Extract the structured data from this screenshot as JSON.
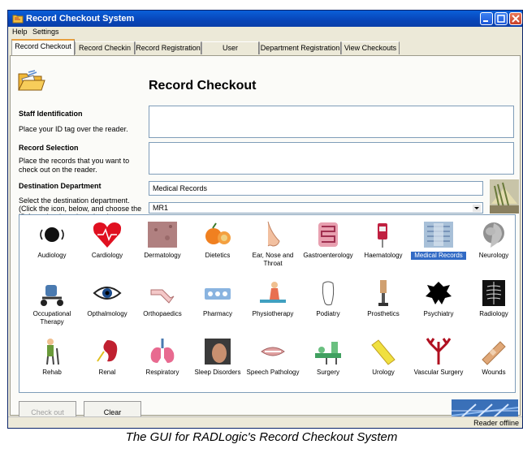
{
  "window": {
    "title": "Record Checkout System"
  },
  "menu": [
    "Help",
    "Settings"
  ],
  "tabs": [
    "Record Checkout",
    "Record Checkin",
    "Record Registration",
    "User Registration",
    "Department Registration",
    "View Checkouts"
  ],
  "page_title": "Record Checkout",
  "staff": {
    "label": "Staff Identification",
    "help": "Place your ID tag over the reader.",
    "value": ""
  },
  "records": {
    "label": "Record Selection",
    "help": "Place the records that you want to check out on the reader.",
    "value": ""
  },
  "destination": {
    "label": "Destination Department",
    "help": "Select the destination department. (Click the icon, below, and choose the ID from the drop-down box.)",
    "department_value": "Medical Records",
    "id_value": "MR1"
  },
  "departments": [
    {
      "label": "Audiology",
      "icon": "ear-sound-icon",
      "selected": false
    },
    {
      "label": "Cardiology",
      "icon": "heart-icon",
      "selected": false
    },
    {
      "label": "Dermatology",
      "icon": "skin-icon",
      "selected": false
    },
    {
      "label": "Dietetics",
      "icon": "fruit-icon",
      "selected": false
    },
    {
      "label": "Ear, Nose and Throat",
      "icon": "nose-icon",
      "selected": false
    },
    {
      "label": "Gastroenterology",
      "icon": "intestine-icon",
      "selected": false
    },
    {
      "label": "Haematology",
      "icon": "blood-bag-icon",
      "selected": false
    },
    {
      "label": "Medical Records",
      "icon": "records-icon",
      "selected": true
    },
    {
      "label": "Neurology",
      "icon": "brain-scan-icon",
      "selected": false
    },
    {
      "label": "Occupational Therapy",
      "icon": "mobility-scooter-icon",
      "selected": false
    },
    {
      "label": "Opthalmology",
      "icon": "eye-icon",
      "selected": false
    },
    {
      "label": "Orthopaedics",
      "icon": "bone-icon",
      "selected": false
    },
    {
      "label": "Pharmacy",
      "icon": "pills-icon",
      "selected": false
    },
    {
      "label": "Physiotherapy",
      "icon": "physio-icon",
      "selected": false
    },
    {
      "label": "Podiatry",
      "icon": "foot-icon",
      "selected": false
    },
    {
      "label": "Prosthetics",
      "icon": "prosthetic-leg-icon",
      "selected": false
    },
    {
      "label": "Psychiatry",
      "icon": "inkblot-icon",
      "selected": false
    },
    {
      "label": "Radiology",
      "icon": "xray-icon",
      "selected": false
    },
    {
      "label": "Rehab",
      "icon": "walking-aid-icon",
      "selected": false
    },
    {
      "label": "Renal",
      "icon": "kidney-icon",
      "selected": false
    },
    {
      "label": "Respiratory",
      "icon": "lungs-icon",
      "selected": false
    },
    {
      "label": "Sleep Disorders",
      "icon": "sleep-icon",
      "selected": false
    },
    {
      "label": "Speech Pathology",
      "icon": "mouth-icon",
      "selected": false
    },
    {
      "label": "Surgery",
      "icon": "surgery-icon",
      "selected": false
    },
    {
      "label": "Urology",
      "icon": "urology-icon",
      "selected": false
    },
    {
      "label": "Vascular Surgery",
      "icon": "vessels-icon",
      "selected": false
    },
    {
      "label": "Wounds",
      "icon": "bandage-icon",
      "selected": false
    }
  ],
  "buttons": {
    "checkout": "Check out",
    "clear": "Clear"
  },
  "status": "Reader offline",
  "caption": "The GUI for RADLogic's Record Checkout System",
  "colors": {
    "titlebar": "#0a4fd0",
    "selection": "#316ac5",
    "panel": "#fbfbf8"
  }
}
